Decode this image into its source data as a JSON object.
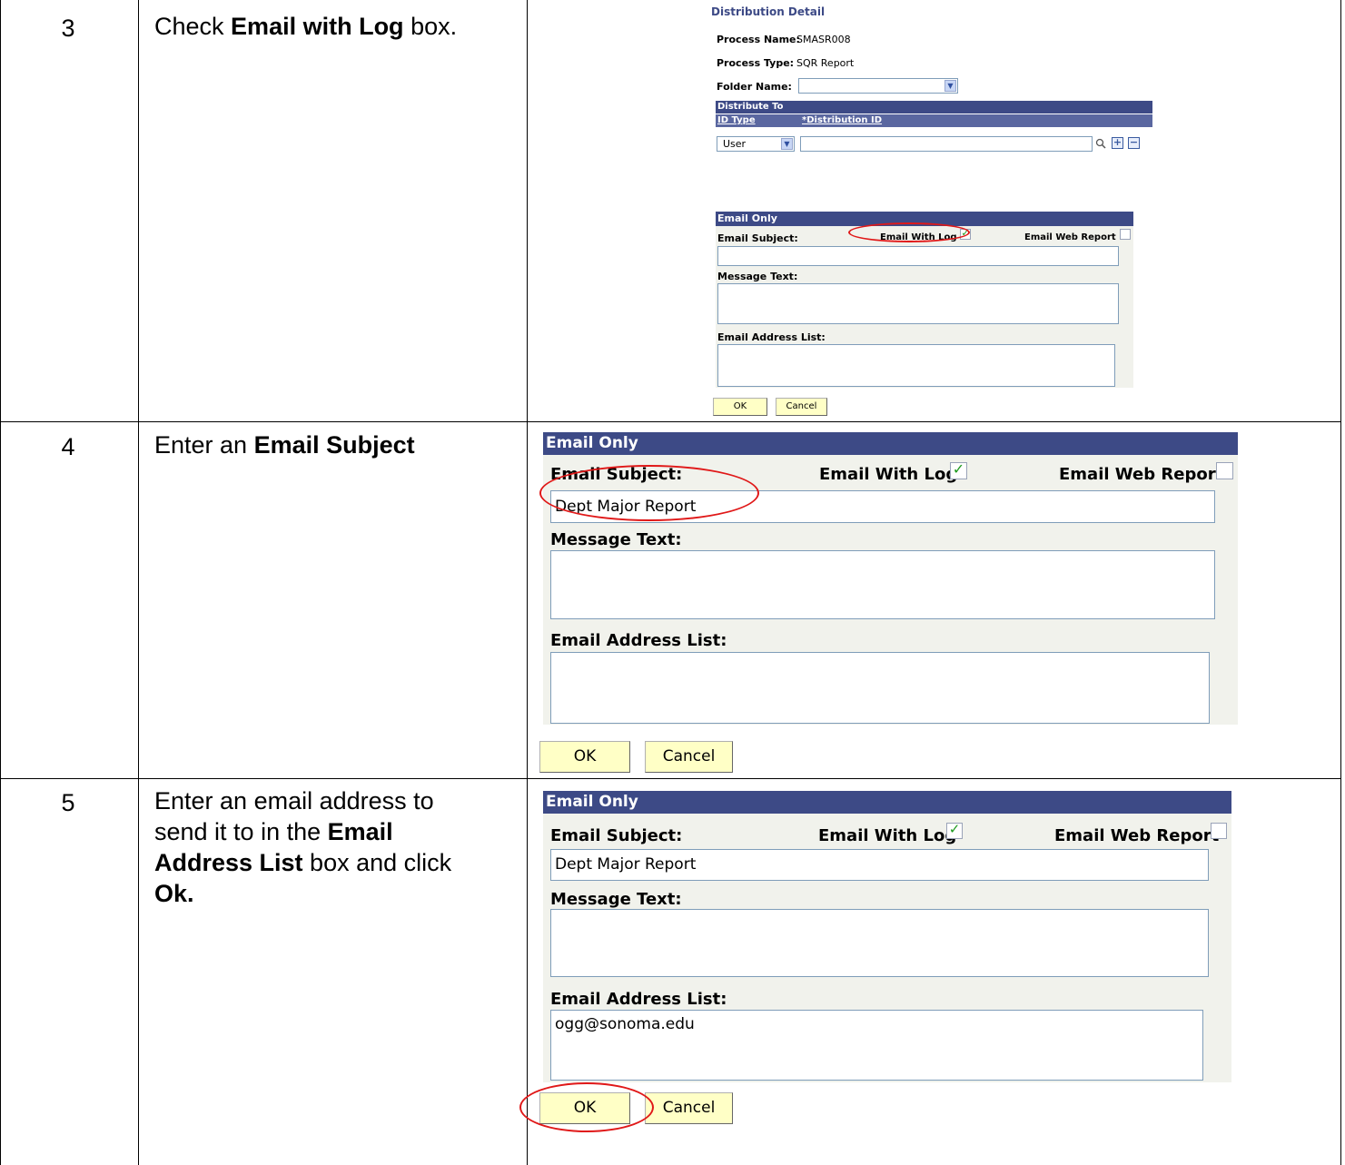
{
  "steps": [
    {
      "number": "3",
      "instruction": {
        "pre": "Check ",
        "bold": "Email with Log",
        "post": " box."
      }
    },
    {
      "number": "4",
      "instruction": {
        "pre": "Enter an ",
        "bold": "Email Subject",
        "post": ""
      }
    },
    {
      "number": "5",
      "instruction": {
        "line1": "Enter an email address to",
        "line2_pre": "send it to in the ",
        "line2_bold": "Email",
        "line3_bold": "Address List",
        "line3_post": " box and click",
        "line4_bold": "Ok."
      }
    }
  ],
  "distribution": {
    "title": "Distribution Detail",
    "process_name_label": "Process Name:",
    "process_name_value": "SMASR008",
    "process_type_label": "Process Type:",
    "process_type_value": "SQR Report",
    "folder_name_label": "Folder Name:",
    "folder_name_value": "",
    "distribute_to_title": "Distribute To",
    "col_id_type": "ID Type",
    "col_distribution_id": "*Distribution ID",
    "id_type_value": "User",
    "distribution_id_value": ""
  },
  "email_labels": {
    "section_title": "Email Only",
    "subject_label": "Email Subject:",
    "with_log_label": "Email With Log",
    "web_report_label": "Email Web Report",
    "message_label": "Message Text:",
    "address_label": "Email Address List:",
    "ok_label": "OK",
    "cancel_label": "Cancel"
  },
  "screens": [
    {
      "subject_value": "",
      "message_value": "",
      "address_value": "",
      "with_log_checked": true,
      "web_report_checked": false
    },
    {
      "subject_value": "Dept Major Report",
      "message_value": "",
      "address_value": "",
      "with_log_checked": true,
      "web_report_checked": false
    },
    {
      "subject_value": "Dept Major Report",
      "message_value": "",
      "address_value": "ogg@sonoma.edu",
      "with_log_checked": true,
      "web_report_checked": false
    }
  ],
  "colors": {
    "header_bar": "#3d4a86",
    "panel_bg": "#f1f2ec",
    "button_bg": "#ffffc6",
    "highlight_ring": "#e01818",
    "checkmark": "#1e9a1e"
  }
}
